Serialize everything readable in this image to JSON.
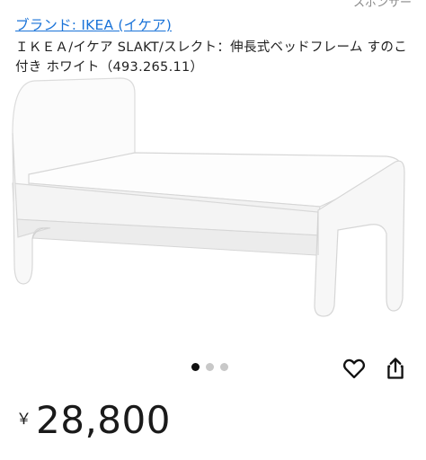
{
  "header": {
    "sponsor_label": "スポンサー"
  },
  "product": {
    "brand_link": "ブランド: IKEA (イケア)",
    "title": "ＩＫＥＡ/イケア SLAKT/スレクト：伸長式ベッドフレーム すのこ付き ホワイト（493.265.11）",
    "image_icon": "white-extendable-bed-image",
    "carousel": {
      "count": 3,
      "active_index": 0
    },
    "price_currency": "￥",
    "price_amount": "28,800"
  },
  "actions": {
    "favorite_icon": "heart-icon",
    "share_icon": "share-icon"
  }
}
